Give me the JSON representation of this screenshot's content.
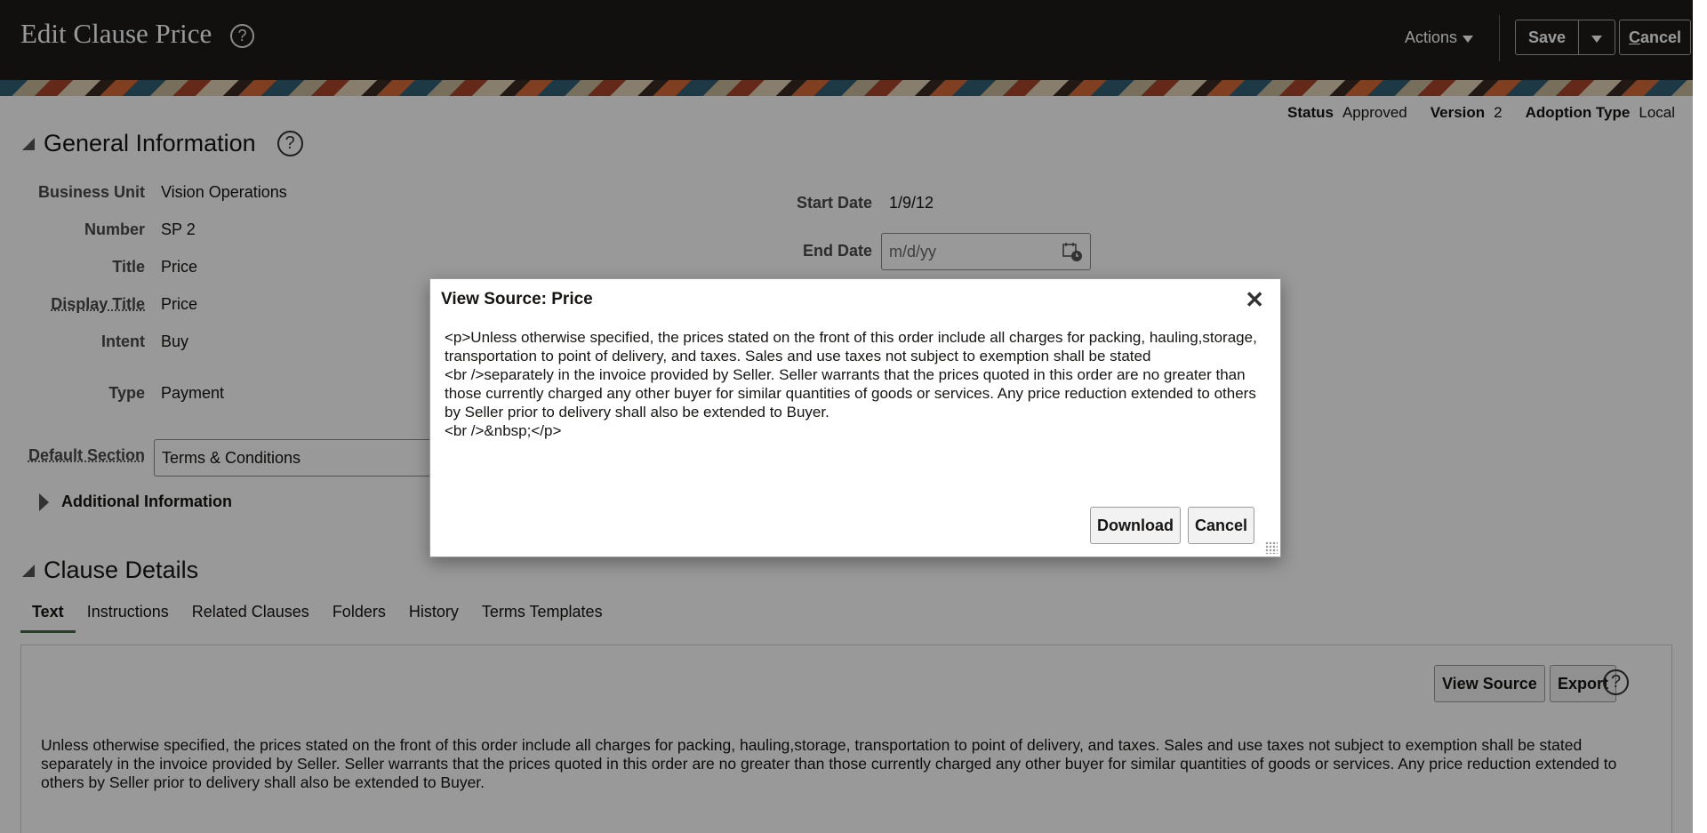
{
  "header": {
    "title": "Edit Clause Price",
    "actions_label": "Actions",
    "save_label": "Save",
    "cancel_first_letter": "C",
    "cancel_rest": "ancel"
  },
  "status": {
    "status_label": "Status",
    "status_value": "Approved",
    "version_label": "Version",
    "version_value": "2",
    "adoption_label": "Adoption Type",
    "adoption_value": "Local"
  },
  "general": {
    "heading": "General Information",
    "business_unit_label": "Business Unit",
    "business_unit_value": "Vision Operations",
    "number_label": "Number",
    "number_value": "SP 2",
    "title_label": "Title",
    "title_value": "Price",
    "display_title_label": "Display Title",
    "display_title_value": "Price",
    "intent_label": "Intent",
    "intent_value": "Buy",
    "type_label": "Type",
    "type_value": "Payment",
    "start_date_label": "Start Date",
    "start_date_value": "1/9/12",
    "end_date_label": "End Date",
    "end_date_placeholder": "m/d/yy",
    "default_section_label": "Default Section",
    "default_section_value": "Terms & Conditions",
    "additional_info_label": "Additional Information"
  },
  "clause_details": {
    "heading": "Clause Details",
    "tabs": [
      "Text",
      "Instructions",
      "Related Clauses",
      "Folders",
      "History",
      "Terms Templates"
    ],
    "view_source_label": "View Source",
    "export_label": "Export",
    "body_text": "Unless otherwise specified, the prices stated on the front of this order include all charges for packing, hauling,storage, transportation to point of delivery, and taxes. Sales and use taxes not subject to exemption shall be stated separately in the invoice provided by Seller. Seller warrants that the prices quoted in this order are no greater than those currently charged any other buyer for similar quantities of goods or services. Any price reduction extended to others by Seller prior to delivery shall also be extended to Buyer."
  },
  "dialog": {
    "title": "View Source: Price",
    "source_line_1": "<p>Unless otherwise specified, the prices stated on the front of this order include all charges for packing, hauling,storage, transportation to point of delivery, and taxes. Sales and use taxes not subject to exemption shall be stated",
    "source_line_2": "<br />separately in the invoice provided by Seller. Seller warrants that the prices quoted in this order are no greater than those currently charged any other buyer for similar quantities of goods or services. Any price reduction extended to others by Seller prior to delivery shall also be extended to Buyer.",
    "source_line_3": "<br />&nbsp;</p>",
    "download_label": "Download",
    "cancel_label": "Cancel"
  },
  "icons": {
    "help": "?",
    "close": "✕"
  },
  "colors": {
    "header_bg": "#1d1c1a",
    "active_tab_underline": "#3e6b3a",
    "overlay": "rgba(0,0,0,0.40)"
  }
}
